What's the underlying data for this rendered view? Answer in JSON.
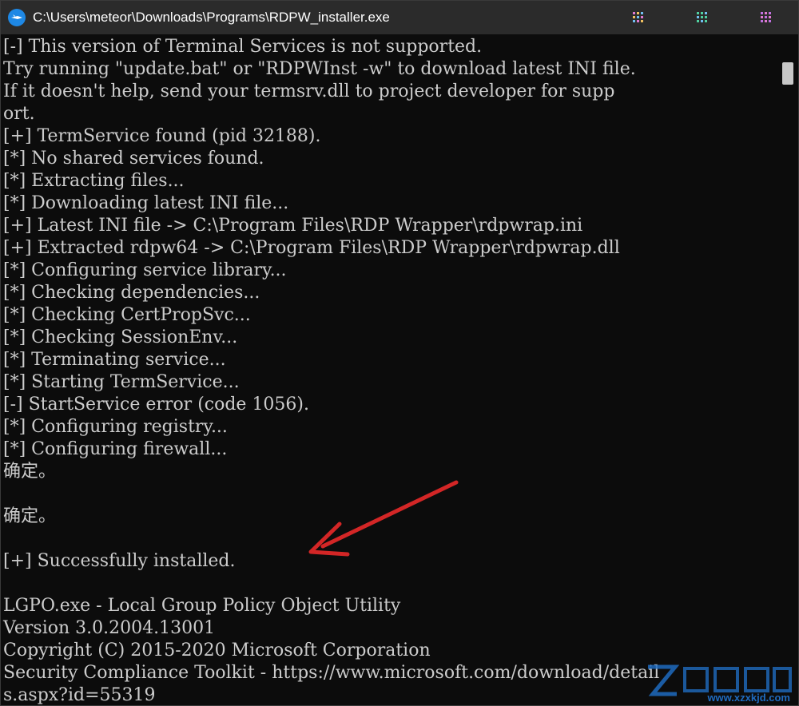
{
  "window": {
    "title": "C:\\Users\\meteor\\Downloads\\Programs\\RDPW_installer.exe"
  },
  "colors": {
    "background": "#0c0c0c",
    "text": "#cccccc",
    "titlebar": "#2b2b2b",
    "arrow": "#d32626",
    "watermark": "#1f6bbf"
  },
  "console": {
    "lines": [
      "[-] This version of Terminal Services is not supported.",
      "Try running \"update.bat\" or \"RDPWInst -w\" to download latest INI file.",
      "If it doesn't help, send your termsrv.dll to project developer for supp",
      "ort.",
      "[+] TermService found (pid 32188).",
      "[*] No shared services found.",
      "[*] Extracting files...",
      "[*] Downloading latest INI file...",
      "[+] Latest INI file -> C:\\Program Files\\RDP Wrapper\\rdpwrap.ini",
      "[+] Extracted rdpw64 -> C:\\Program Files\\RDP Wrapper\\rdpwrap.dll",
      "[*] Configuring service library...",
      "[*] Checking dependencies...",
      "[*] Checking CertPropSvc...",
      "[*] Checking SessionEnv...",
      "[*] Terminating service...",
      "[*] Starting TermService...",
      "[-] StartService error (code 1056).",
      "[*] Configuring registry...",
      "[*] Configuring firewall...",
      "确定。",
      "",
      "确定。",
      "",
      "[+] Successfully installed.",
      "",
      "LGPO.exe - Local Group Policy Object Utility",
      "Version 3.0.2004.13001",
      "Copyright (C) 2015-2020 Microsoft Corporation",
      "Security Compliance Toolkit - https://www.microsoft.com/download/detail",
      "s.aspx?id=55319"
    ]
  },
  "watermark": {
    "url": "www.xzxkjd.com"
  }
}
